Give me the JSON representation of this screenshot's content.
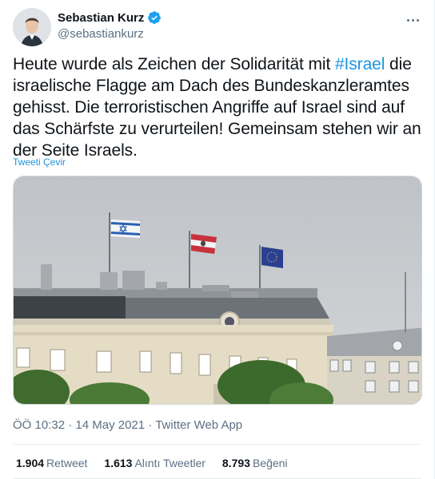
{
  "author": {
    "name": "Sebastian Kurz",
    "handle": "@sebastiankurz",
    "verified": true
  },
  "tweet": {
    "text_before": "Heute wurde als Zeichen der Solidarität mit ",
    "hashtag": "#Israel",
    "text_after": " die israelische Flagge am Dach des Bundeskanzleramtes gehisst. Die terroristischen Angriffe auf Israel sind auf das Schärfste zu verurteilen! Gemeinsam stehen wir an der Seite Israels.",
    "translate_label": "Tweeti Çevir"
  },
  "meta": {
    "time": "ÖÖ 10:32",
    "separator": "·",
    "date": "14 May 2021",
    "app": "Twitter Web App"
  },
  "stats": {
    "retweets_count": "1.904",
    "retweets_label": "Retweet",
    "quotes_count": "1.613",
    "quotes_label": "Alıntı Tweetler",
    "likes_count": "8.793",
    "likes_label": "Beğeni"
  },
  "colors": {
    "link": "#1b95e0",
    "secondary_text": "#5b7083",
    "divider": "#e6ecf0",
    "verified": "#1da1f2"
  }
}
